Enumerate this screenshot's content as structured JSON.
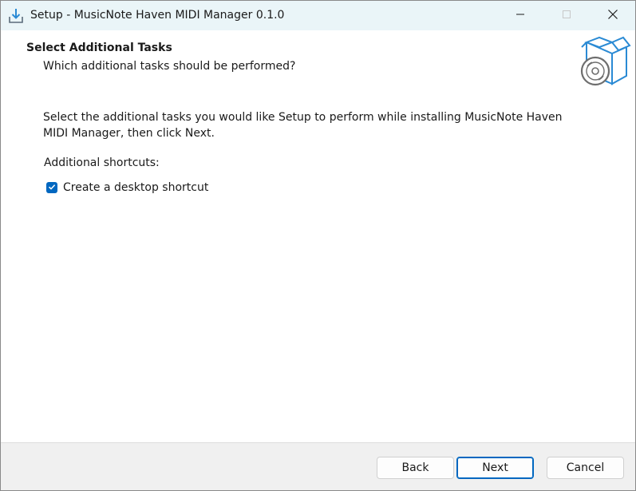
{
  "window": {
    "title": "Setup - MusicNote Haven MIDI Manager 0.1.0",
    "app_icon": "installer-download-icon",
    "controls": {
      "minimize": "minimize-icon",
      "maximize": "maximize-icon",
      "close": "close-icon"
    }
  },
  "header": {
    "title": "Select Additional Tasks",
    "subtitle": "Which additional tasks should be performed?",
    "image": "software-box-disc-icon"
  },
  "body": {
    "description": "Select the additional tasks you would like Setup to perform while installing MusicNote Haven MIDI Manager, then click Next.",
    "group_label": "Additional shortcuts:",
    "tasks": [
      {
        "label": "Create a desktop shortcut",
        "checked": true
      }
    ]
  },
  "footer": {
    "back_label": "Back",
    "next_label": "Next",
    "cancel_label": "Cancel"
  },
  "colors": {
    "accent": "#0067c0",
    "titlebar_bg": "#eaf5f8",
    "footer_bg": "#f0f0f0"
  }
}
